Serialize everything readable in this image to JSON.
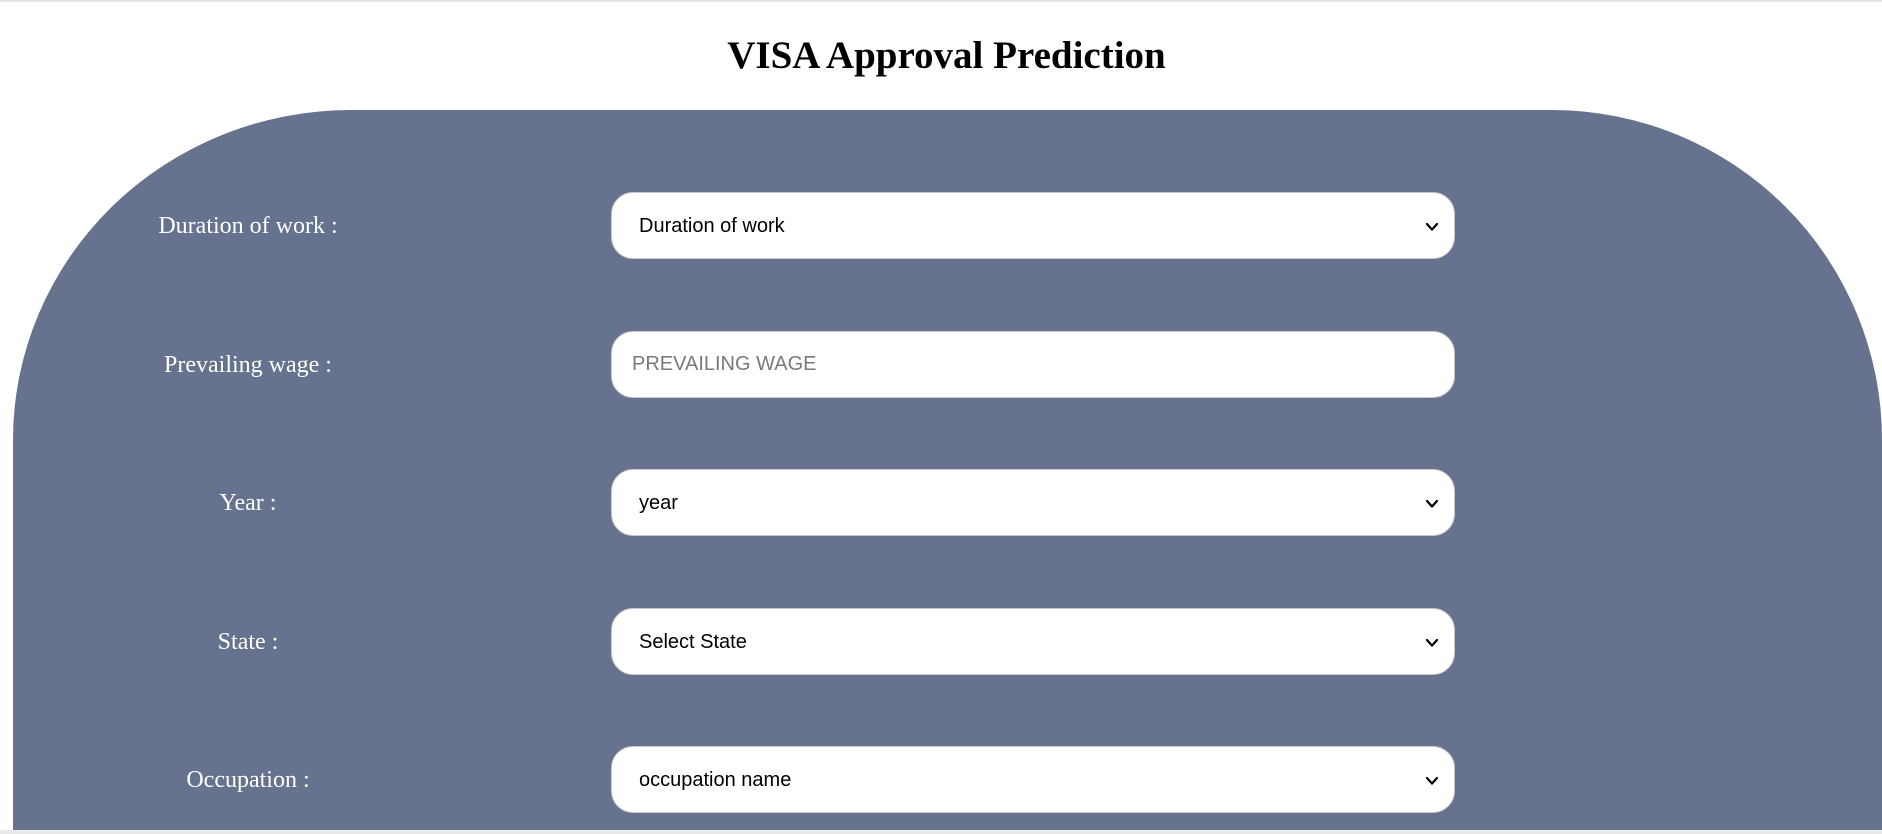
{
  "page": {
    "title": "VISA Approval Prediction"
  },
  "form": {
    "fields": [
      {
        "label": "Duration of work :",
        "type": "select",
        "value": "Duration of work"
      },
      {
        "label": "Prevailing wage :",
        "type": "input",
        "placeholder": "PREVAILING WAGE"
      },
      {
        "label": "Year :",
        "type": "select",
        "value": "year"
      },
      {
        "label": "State :",
        "type": "select",
        "value": "Select State"
      },
      {
        "label": "Occupation :",
        "type": "select",
        "value": "occupation name"
      }
    ]
  },
  "icons": {
    "dropdown": "chevron-down-icon"
  },
  "colors": {
    "panel_background": "#67728f",
    "field_background": "#ffffff",
    "label_text": "#ffffff"
  }
}
